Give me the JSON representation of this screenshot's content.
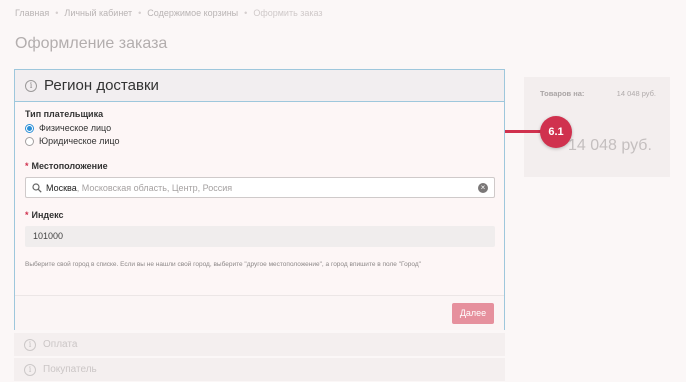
{
  "breadcrumb": {
    "items": [
      "Главная",
      "Личный кабинет",
      "Содержимое корзины"
    ],
    "current": "Оформить заказ"
  },
  "page_title": "Оформление заказа",
  "region": {
    "title": "Регион доставки",
    "payer_type_label": "Тип плательщика",
    "payer_options": [
      "Физическое лицо",
      "Юридическое лицо"
    ],
    "selected_payer": "Физическое лицо",
    "location_label": "Местоположение",
    "location_city": "Москва",
    "location_rest": ", Московская область, Центр, Россия",
    "index_label": "Индекс",
    "index_value": "101000",
    "hint": "Выберите свой город в списке. Если вы не нашли свой город, выберите \"другое местоположение\", а город впишите в поле \"Город\"",
    "next_button": "Далее",
    "required_mark": "*"
  },
  "collapsed_sections": [
    "Оплата",
    "Покупатель"
  ],
  "summary": {
    "items_label": "Товаров на:",
    "items_value": "14 048 руб.",
    "total": "14 048 руб."
  },
  "callout": {
    "label": "6.1",
    "color": "#d0314e"
  },
  "colors": {
    "accent_border": "#9ec7dc",
    "button": "#e6909d",
    "radio_selected": "#2b8fd6"
  },
  "icons": {
    "section": "info-icon",
    "search": "search-icon",
    "clear": "clear-icon"
  }
}
